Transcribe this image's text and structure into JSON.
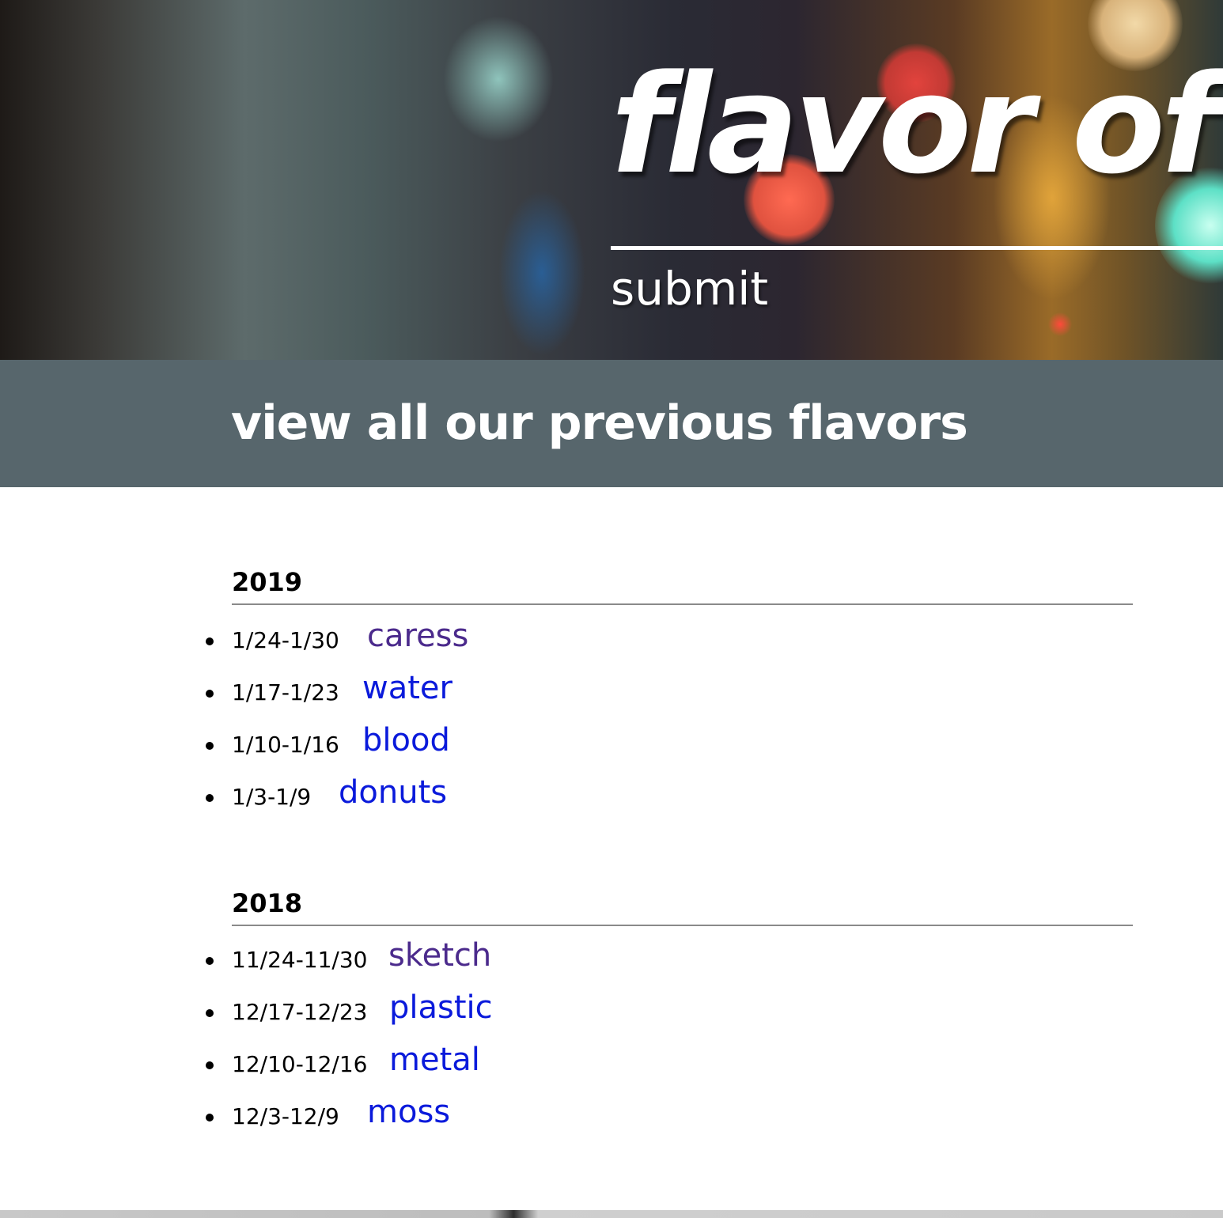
{
  "hero": {
    "title": "flavor of",
    "submit_label": "submit"
  },
  "banner": {
    "title": "view all our previous flavors"
  },
  "years": [
    {
      "year": "2019",
      "entries": [
        {
          "dates": "1/24-1/30",
          "flavor": "caress",
          "visited": true
        },
        {
          "dates": "1/17-1/23",
          "flavor": "water",
          "visited": false
        },
        {
          "dates": "1/10-1/16",
          "flavor": "blood",
          "visited": false
        },
        {
          "dates": "1/3-1/9",
          "flavor": "donuts",
          "visited": false
        }
      ]
    },
    {
      "year": "2018",
      "entries": [
        {
          "dates": "11/24-11/30",
          "flavor": "sketch",
          "visited": true
        },
        {
          "dates": "12/17-12/23",
          "flavor": "plastic",
          "visited": false
        },
        {
          "dates": "12/10-12/16",
          "flavor": "metal",
          "visited": false
        },
        {
          "dates": "12/3-12/9",
          "flavor": "moss",
          "visited": false
        }
      ]
    }
  ],
  "colors": {
    "banner_bg": "#57666c",
    "link_unvisited": "#0a1adb",
    "link_visited": "#4b2a8c"
  }
}
